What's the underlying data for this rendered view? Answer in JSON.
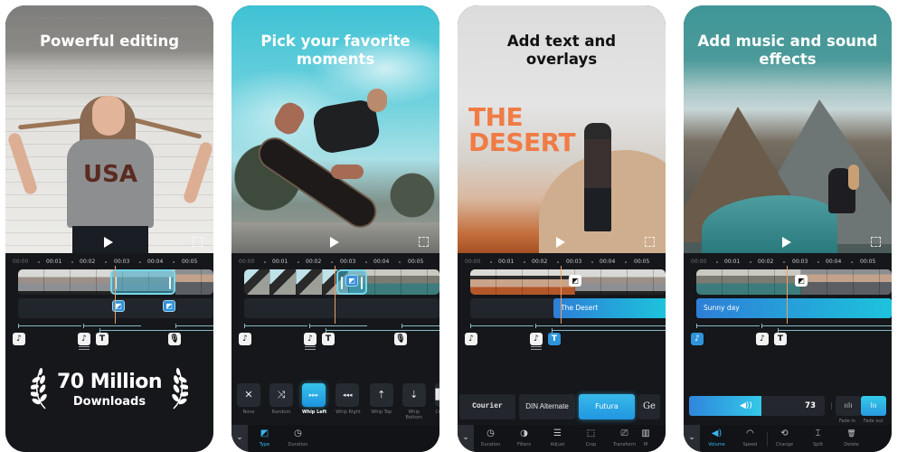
{
  "panels": [
    {
      "headline": "Powerful editing",
      "award": {
        "count": "70 Million",
        "label": "Downloads"
      }
    },
    {
      "headline": "Pick your favorite moments",
      "transitions": [
        {
          "label": "None",
          "icon": "✕"
        },
        {
          "label": "Random",
          "icon": "⤨"
        },
        {
          "label": "Whip Left",
          "icon": "▸▸▸",
          "selected": true
        },
        {
          "label": "Whip Right",
          "icon": "◂◂◂"
        },
        {
          "label": "Whip Top",
          "icon": "⇡"
        },
        {
          "label": "Whip Bottom",
          "icon": "⇣"
        },
        {
          "label": "Cro",
          "icon": "▌"
        }
      ],
      "toolbar": [
        {
          "label": "Type",
          "icon": "◩",
          "active": true
        },
        {
          "label": "Duration",
          "icon": "◷"
        }
      ]
    },
    {
      "headline": "Add text and overlays",
      "overlay_title": "THE DESERT",
      "text_clip": "The Desert",
      "fonts": [
        {
          "label": "Courier"
        },
        {
          "label": "DIN Alternate"
        },
        {
          "label": "Futura",
          "selected": true
        },
        {
          "label": "Ge"
        }
      ],
      "toolbar": [
        {
          "label": "Duration",
          "icon": "◷"
        },
        {
          "label": "Filters",
          "icon": "◑"
        },
        {
          "label": "Adjust",
          "icon": "☰"
        },
        {
          "label": "Crop",
          "icon": "⬚"
        },
        {
          "label": "Transform",
          "icon": "⎚"
        },
        {
          "label": "M",
          "icon": "▥"
        }
      ]
    },
    {
      "headline": "Add music and sound effects",
      "audio_clip": "Sunny day",
      "volume": {
        "value": "73",
        "fraction": 0.53
      },
      "fade_in": "Fade in",
      "fade_out": "Fade out",
      "toolbar": [
        {
          "label": "Volume",
          "icon": "◀)",
          "active": true
        },
        {
          "label": "Speed",
          "icon": "◠"
        },
        {
          "label": "Change",
          "icon": "⟲"
        },
        {
          "label": "Split",
          "icon": "⌶"
        },
        {
          "label": "Delete",
          "icon": "🗑"
        }
      ]
    }
  ],
  "timeline": {
    "ticks": [
      "00:00",
      "00:01",
      "00:02",
      "00:03",
      "00:04",
      "00:05"
    ]
  },
  "icons": {
    "music_note": "♪",
    "text": "T",
    "mic": "🎙",
    "transition": "◩",
    "collapse": "⌄",
    "fade_in": "ıılı",
    "fade_out": "lıı",
    "speaker": "◀))"
  },
  "colors": {
    "accent": "#2f95db",
    "accent_light": "#37c3ea",
    "playhead": "#e8a26a",
    "overlay_title": "#f07c45",
    "background": "#15171b"
  }
}
